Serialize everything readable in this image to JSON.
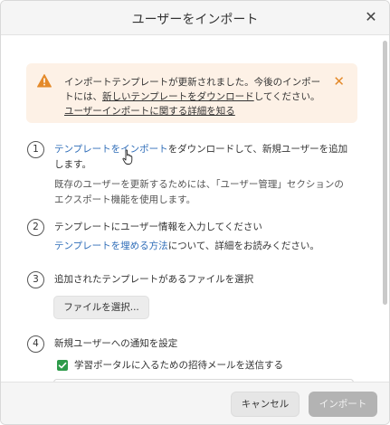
{
  "dialog": {
    "title": "ユーザーをインポート",
    "close_icon": "close-icon"
  },
  "banner": {
    "icon": "warning-icon",
    "line1": "インポートテンプレートが更新されました。今後のインポー",
    "line2_prefix": "トには、",
    "line2_link": "新しいテンプレートをダウンロード",
    "line2_suffix": "してください。",
    "line3_link": "ユーザーインポートに関する詳細を知る",
    "close_icon": "close-icon",
    "accent": "#e48a2b"
  },
  "steps": [
    {
      "number": "1",
      "link": "テンプレートをインポート",
      "text_after_link": "をダウンロードして、新規ユーザーを追加",
      "text_line2": "します。",
      "note_line1": "既存のユーザーを更新するためには、「ユーザー管理」セクションの",
      "note_line2": "エクスポート機能を使用します。"
    },
    {
      "number": "2",
      "text": "テンプレートにユーザー情報を入力してください",
      "link": "テンプレートを埋める方法",
      "text_after_link": "について、詳細をお読みください。"
    },
    {
      "number": "3",
      "text": "追加されたテンプレートがあるファイルを選択",
      "button": "ファイルを選択..."
    },
    {
      "number": "4",
      "text": "新規ユーザーへの通知を設定",
      "checkbox_label": "学習ポータルに入るための招待メールを送信する",
      "checkbox_checked": true
    }
  ],
  "footer": {
    "cancel": "キャンセル",
    "import": "インポート"
  },
  "colors": {
    "link": "#2f6db8",
    "checkbox": "#2e9b4a",
    "banner_bg": "#fdf1e6",
    "disabled_button": "#b3b3b3"
  }
}
